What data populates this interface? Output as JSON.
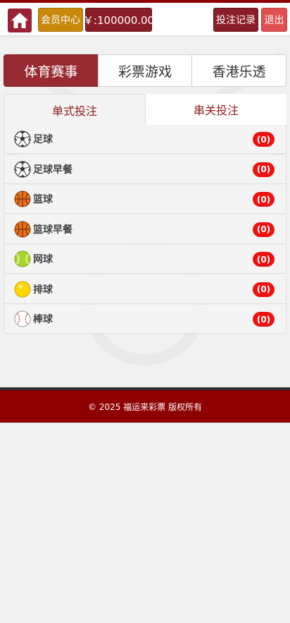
{
  "header": {
    "home_icon": "home-icon",
    "member_center": "会员中心",
    "balance": "￥:100000.00",
    "bet_records": "投注记录",
    "logout": "退出"
  },
  "main_tabs": [
    {
      "label": "体育赛事",
      "active": true
    },
    {
      "label": "彩票游戏",
      "active": false
    },
    {
      "label": "香港乐透",
      "active": false
    }
  ],
  "sub_tabs": [
    {
      "label": "单式投注",
      "active": true
    },
    {
      "label": "串关投注",
      "active": false
    }
  ],
  "sports": [
    {
      "name": "足球",
      "count": "(0)",
      "icon": "soccer-ball-icon"
    },
    {
      "name": "足球早餐",
      "count": "(0)",
      "icon": "soccer-ball-icon"
    },
    {
      "name": "篮球",
      "count": "(0)",
      "icon": "basketball-icon"
    },
    {
      "name": "篮球早餐",
      "count": "(0)",
      "icon": "basketball-icon"
    },
    {
      "name": "网球",
      "count": "(0)",
      "icon": "tennis-ball-icon"
    },
    {
      "name": "排球",
      "count": "(0)",
      "icon": "volleyball-icon"
    },
    {
      "name": "棒球",
      "count": "(0)",
      "icon": "baseball-icon"
    }
  ],
  "footer": {
    "copyright": "© 2025 福运来彩票 版权所有"
  },
  "colors": {
    "brand_dark_red": "#8e0000",
    "active_tab": "#982b31",
    "member_gold": "#c8890d",
    "logout_red": "#e05050",
    "badge_red": "#ee1111"
  }
}
